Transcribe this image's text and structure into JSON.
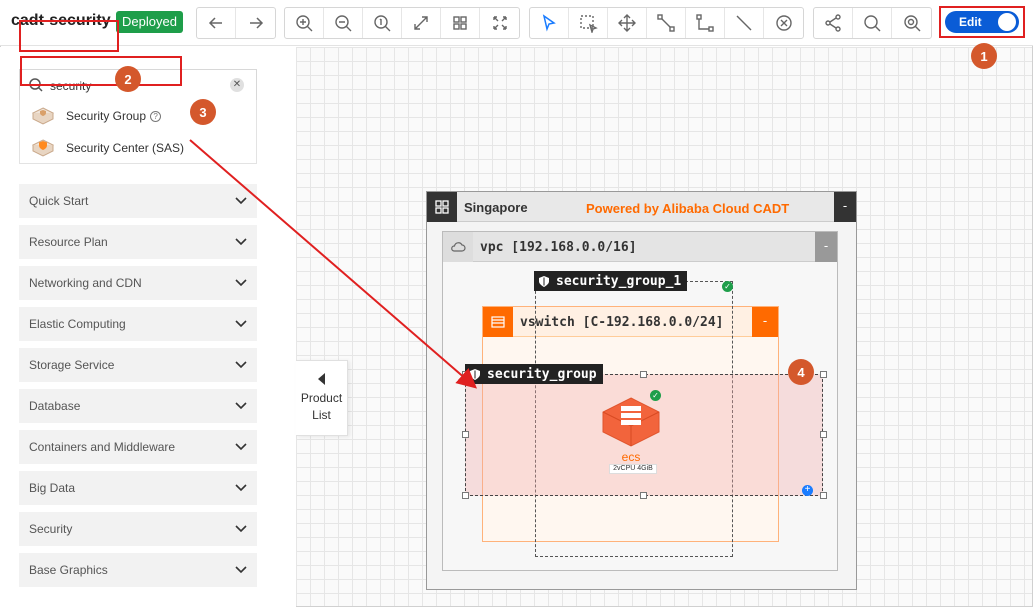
{
  "toolbar": {
    "app_title": "cadt-security",
    "status": "Deployed",
    "edit_label": "Edit",
    "groups": [
      {
        "name": "history",
        "icons": [
          "undo-icon",
          "redo-icon"
        ]
      },
      {
        "name": "view",
        "icons": [
          "zoom-in-icon",
          "zoom-out-icon",
          "zoom-reset-icon",
          "fit-icon",
          "grid-icon",
          "fullscreen-icon"
        ]
      },
      {
        "name": "tools",
        "icons": [
          "select-icon",
          "marquee-icon",
          "move-icon",
          "connect-icon",
          "elbow-icon",
          "line-icon",
          "delete-icon"
        ]
      },
      {
        "name": "misc",
        "icons": [
          "share-icon",
          "search-icon",
          "search-node-icon"
        ]
      }
    ]
  },
  "callouts": [
    "1",
    "2",
    "3",
    "4"
  ],
  "sidebar": {
    "search_value": "security",
    "results": [
      {
        "label": "Security Group",
        "help": "?"
      },
      {
        "label": "Security Center (SAS)"
      }
    ],
    "categories": [
      "Quick Start",
      "Resource Plan",
      "Networking and CDN",
      "Elastic Computing",
      "Storage Service",
      "Database",
      "Containers and Middleware",
      "Big Data",
      "Security",
      "Base Graphics"
    ],
    "product_list_line1": "Product",
    "product_list_line2": "List"
  },
  "canvas": {
    "region": {
      "name": "Singapore",
      "powered_by": "Powered by Alibaba Cloud CADT",
      "collapse": "-"
    },
    "vpc": {
      "name": "vpc [192.168.0.0/16]",
      "collapse": "-"
    },
    "vswitch": {
      "name": "vswitch [C-192.168.0.0/24]",
      "collapse": "-"
    },
    "security_group_1": "security_group_1",
    "security_group": "security_group",
    "ecs": {
      "name": "ecs",
      "spec": "2vCPU  4GiB"
    },
    "colors": {
      "accent": "#ff6a00",
      "selection": "#1a7cff",
      "highlight": "#e02020",
      "callout": "#d4582c"
    }
  }
}
